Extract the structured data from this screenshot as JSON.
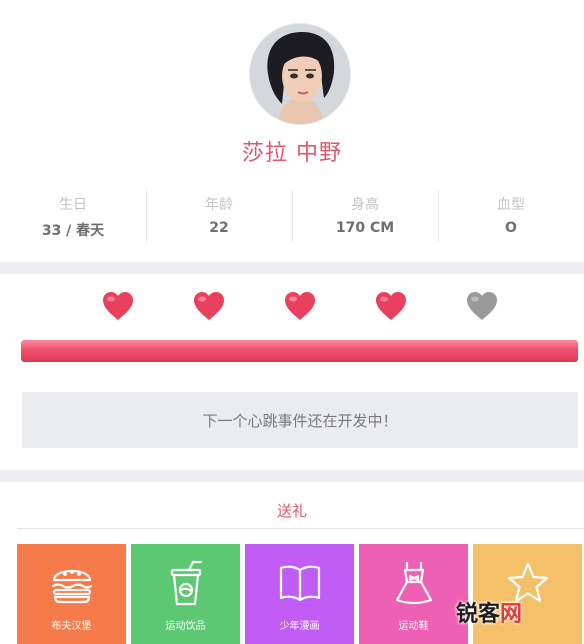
{
  "profile": {
    "name": "莎拉 中野",
    "stats": [
      {
        "label": "生日",
        "value": "33 / 春天"
      },
      {
        "label": "年龄",
        "value": "22"
      },
      {
        "label": "身高",
        "value": "170 CM"
      },
      {
        "label": "血型",
        "value": "O"
      }
    ]
  },
  "affection": {
    "hearts_filled": 4,
    "hearts_total": 5,
    "progress_fraction": 1.0,
    "notice": "下一个心跳事件还在开发中！"
  },
  "gifts": {
    "title": "送礼",
    "items": [
      {
        "label": "布夫汉堡",
        "icon": "burger-icon",
        "color": "#f57b4a"
      },
      {
        "label": "运动饮品",
        "icon": "drink-cup-icon",
        "color": "#5dc873"
      },
      {
        "label": "少年漫画",
        "icon": "book-icon",
        "color": "#c15cf5"
      },
      {
        "label": "运动鞋",
        "icon": "dress-icon",
        "color": "#ee60b3"
      },
      {
        "label": "",
        "icon": "star-icon",
        "color": "#f4c16a"
      }
    ]
  },
  "watermark": {
    "part1": "锐客",
    "part2": "网"
  },
  "colors": {
    "accent": "#e0566f",
    "heart_filled": "#e8415e",
    "heart_empty": "#9a9a9a"
  }
}
